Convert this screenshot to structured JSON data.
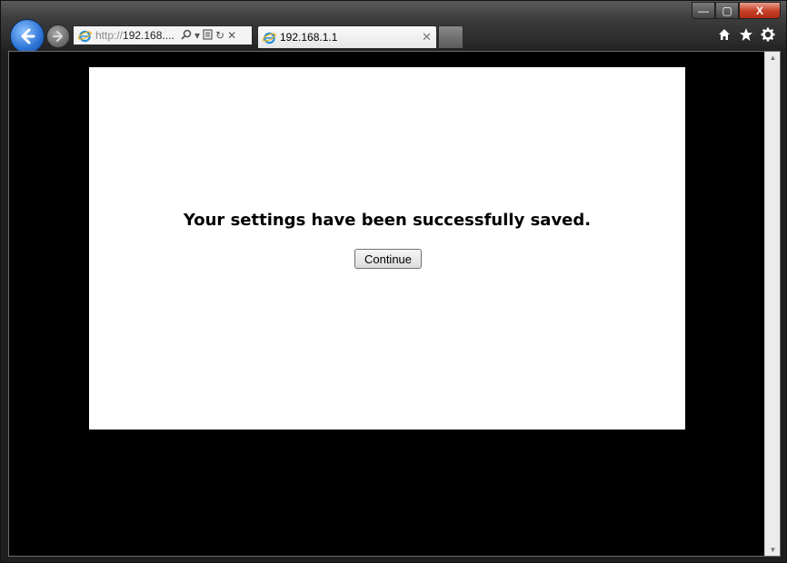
{
  "browser": {
    "address_scheme": "http://",
    "address_host": "192.168....",
    "tab_title": "192.168.1.1",
    "caption": {
      "minimize": "—",
      "maximize": "▢",
      "close": "X"
    }
  },
  "page": {
    "message": "Your settings have been successfully saved.",
    "continue_label": "Continue"
  }
}
